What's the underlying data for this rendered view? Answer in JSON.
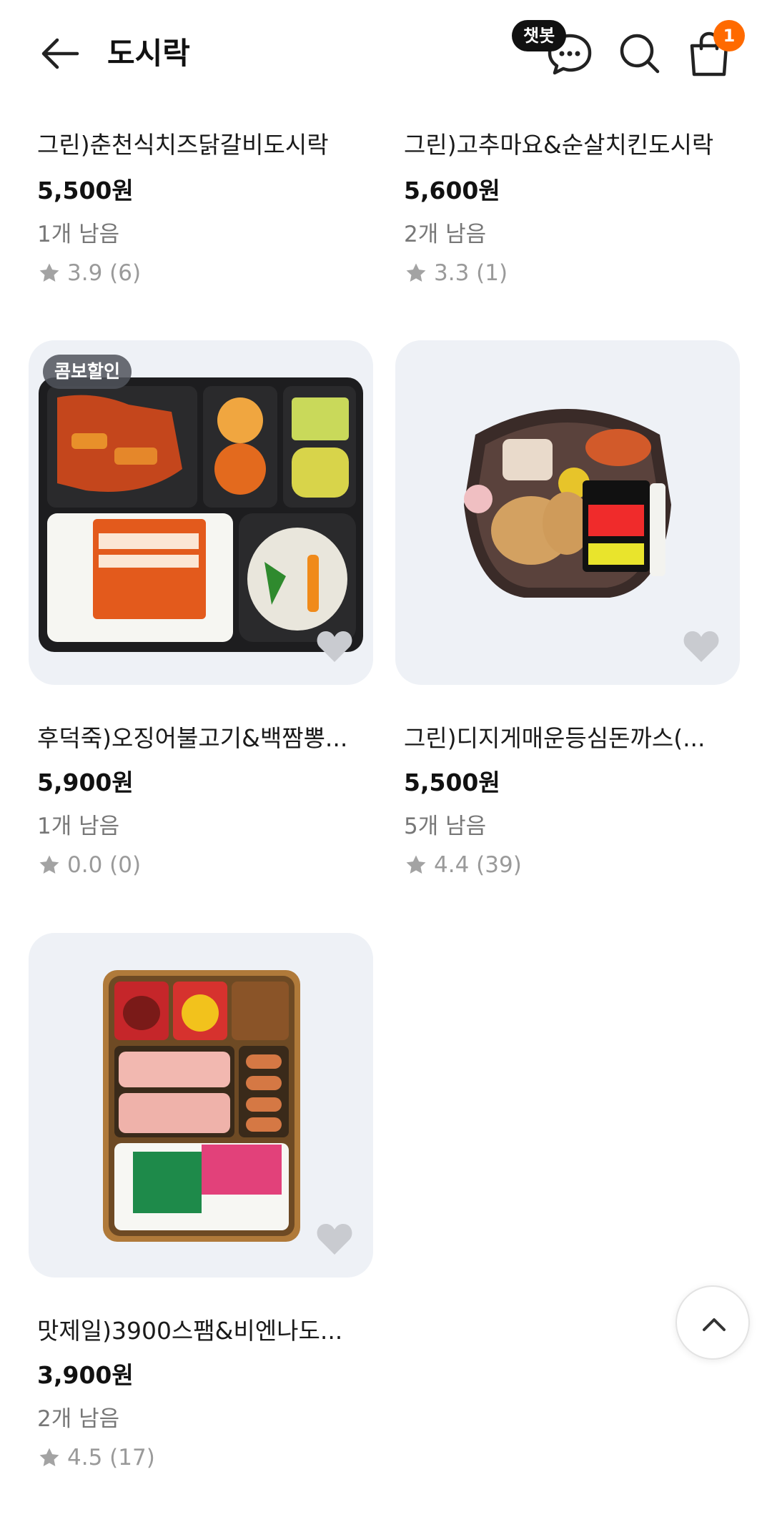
{
  "header": {
    "title": "도시락",
    "chatbot_label": "챗봇",
    "cart_count": "1"
  },
  "products": [
    {
      "name": "그린)춘천식치즈닭갈비도시락",
      "price": "5,500원",
      "stock": "1개 남음",
      "rating": "3.9 (6)"
    },
    {
      "name": "그린)고추마요&순살치킨도시락",
      "price": "5,600원",
      "stock": "2개 남음",
      "rating": "3.3 (1)"
    },
    {
      "tag": "콤보할인",
      "name": "후덕죽)오징어불고기&백짬뽕...",
      "price": "5,900원",
      "stock": "1개 남음",
      "rating": "0.0 (0)"
    },
    {
      "name": "그린)디지게매운등심돈까스(...",
      "price": "5,500원",
      "stock": "5개 남음",
      "rating": "4.4 (39)"
    },
    {
      "name": "맛제일)3900스팸&비엔나도...",
      "price": "3,900원",
      "stock": "2개 남음",
      "rating": "4.5 (17)"
    }
  ],
  "colors": {
    "accent_badge": "#ff6a00",
    "card_bg": "#eef1f6"
  }
}
